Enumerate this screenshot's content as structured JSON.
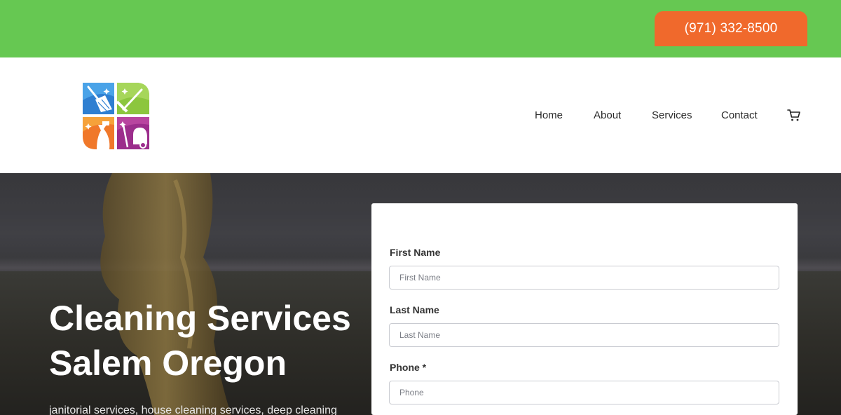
{
  "topbar": {
    "phone": "(971) 332-8500",
    "background": "#66c852",
    "button_color": "#f0692c"
  },
  "header": {
    "logo_icons": [
      "broom-icon",
      "squeegee-icon",
      "spray-bottle-icon",
      "vacuum-icon"
    ],
    "nav": [
      {
        "label": "Home"
      },
      {
        "label": "About"
      },
      {
        "label": "Services"
      },
      {
        "label": "Contact"
      }
    ],
    "cart_icon": "cart-icon"
  },
  "hero": {
    "title_line1": "Cleaning Services",
    "title_line2": "Salem Oregon",
    "subtitle": "janitorial services, house cleaning services, deep cleaning"
  },
  "form": {
    "fields": [
      {
        "label": "First Name",
        "placeholder": "First Name"
      },
      {
        "label": "Last Name",
        "placeholder": "Last Name"
      },
      {
        "label": "Phone *",
        "placeholder": "Phone"
      }
    ]
  }
}
